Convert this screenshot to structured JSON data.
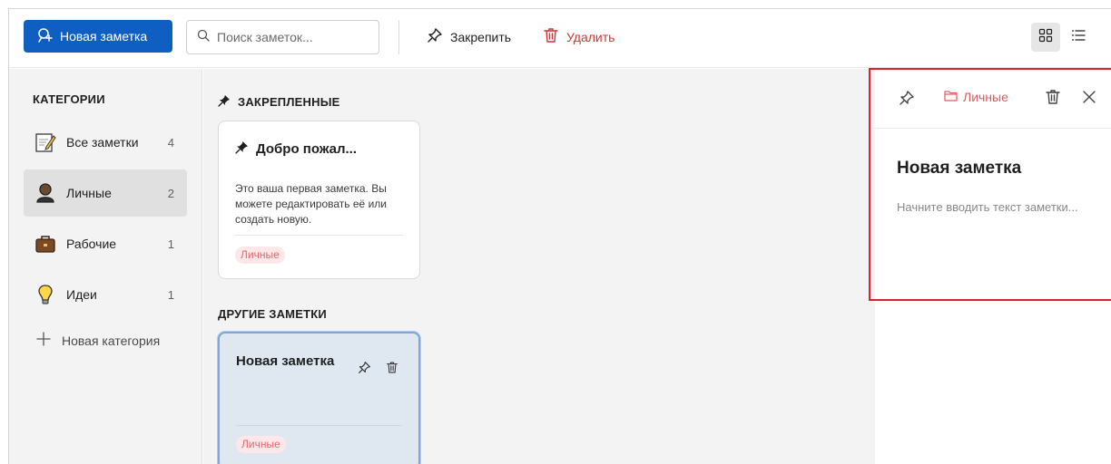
{
  "toolbar": {
    "new_note_label": "Новая заметка",
    "search_placeholder": "Поиск заметок...",
    "pin_label": "Закрепить",
    "delete_label": "Удалить"
  },
  "sidebar": {
    "title": "КАТЕГОРИИ",
    "categories": [
      {
        "label": "Все заметки",
        "count": "4",
        "icon": "memo-icon"
      },
      {
        "label": "Личные",
        "count": "2",
        "icon": "person-icon"
      },
      {
        "label": "Рабочие",
        "count": "1",
        "icon": "briefcase-icon"
      },
      {
        "label": "Идеи",
        "count": "1",
        "icon": "lightbulb-icon"
      }
    ],
    "add_category_label": "Новая категория"
  },
  "notes": {
    "pinned_title": "ЗАКРЕПЛЕННЫЕ",
    "other_title": "ДРУГИЕ ЗАМЕТКИ",
    "pinned": [
      {
        "title": "Добро пожал...",
        "body": "Это ваша первая заметка. Вы можете редактировать её или создать новую.",
        "tag": "Личные"
      }
    ],
    "other": [
      {
        "title": "Новая заметка",
        "body": "",
        "tag": "Личные"
      }
    ]
  },
  "detail": {
    "category": "Личные",
    "title": "Новая заметка",
    "placeholder": "Начните вводить текст заметки..."
  },
  "colors": {
    "accent": "#0f5fc2",
    "danger": "#d13438",
    "tag_bg": "#fde7e8",
    "tag_text": "#e06a6f",
    "highlight": "#d9232e"
  }
}
